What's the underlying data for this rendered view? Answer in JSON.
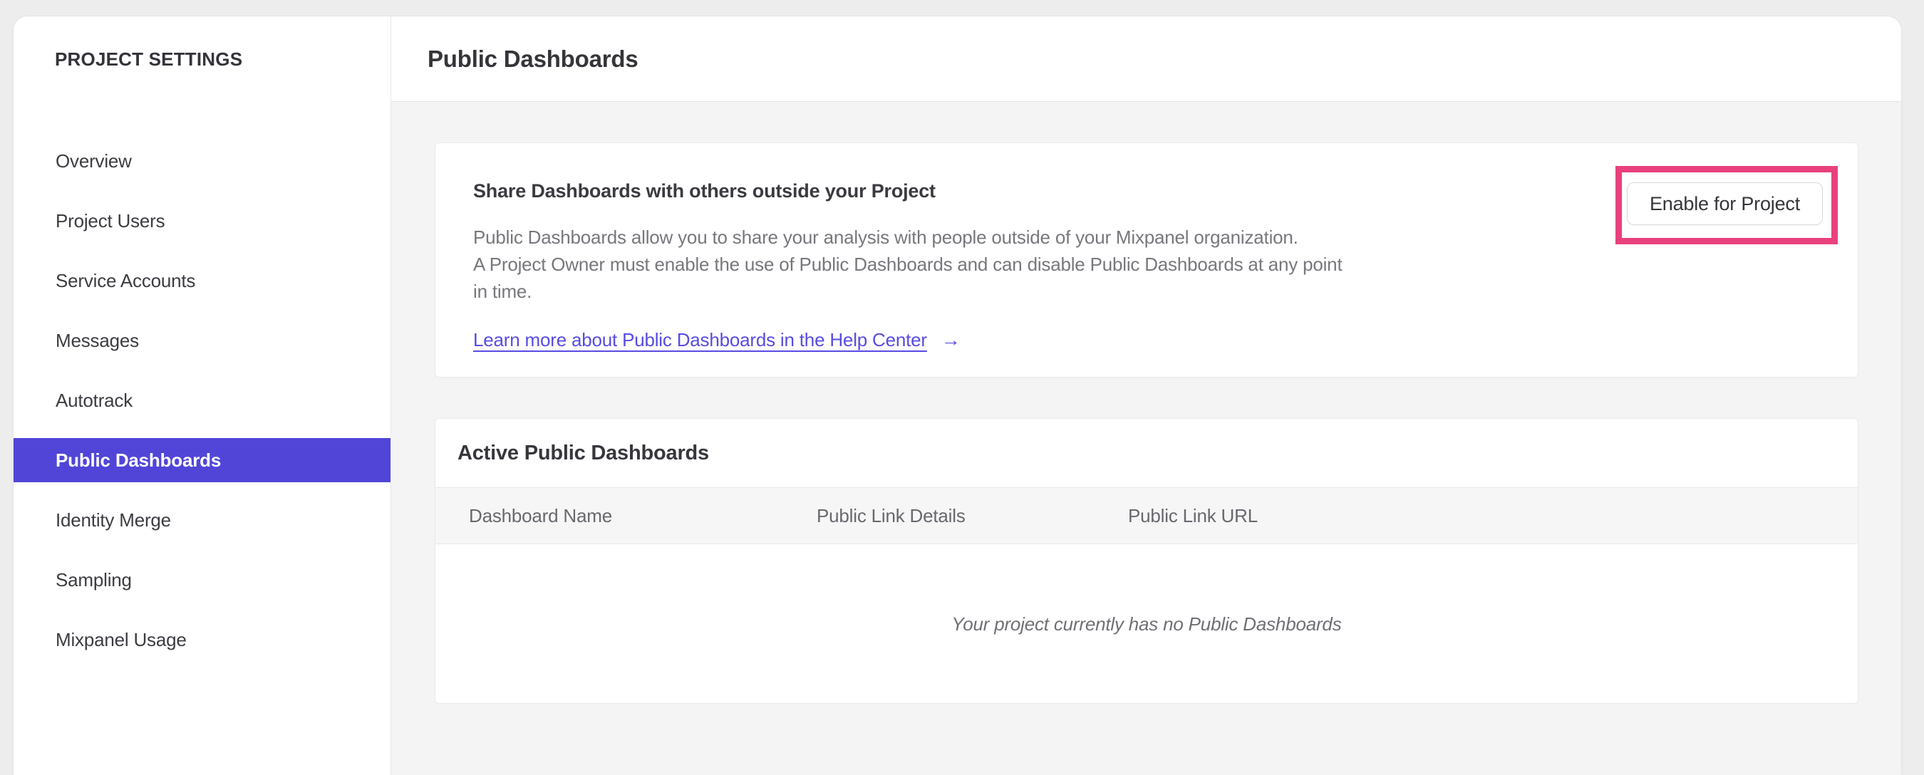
{
  "sidebar": {
    "title": "PROJECT SETTINGS",
    "items": [
      {
        "label": "Overview"
      },
      {
        "label": "Project Users"
      },
      {
        "label": "Service Accounts"
      },
      {
        "label": "Messages"
      },
      {
        "label": "Autotrack"
      },
      {
        "label": "Public Dashboards",
        "active": true
      },
      {
        "label": "Identity Merge"
      },
      {
        "label": "Sampling"
      },
      {
        "label": "Mixpanel Usage"
      }
    ]
  },
  "header": {
    "title": "Public Dashboards"
  },
  "share_card": {
    "heading": "Share Dashboards with others outside your Project",
    "body_lines": [
      "Public Dashboards allow you to share your analysis with people outside of your Mixpanel organization.",
      "A Project Owner must enable the use of Public Dashboards and can disable Public Dashboards at any point",
      "in time."
    ],
    "link_label": "Learn more about Public Dashboards in the Help Center",
    "link_arrow": "→",
    "button_label": "Enable for Project"
  },
  "dashboards_card": {
    "title": "Active Public Dashboards",
    "columns": [
      "Dashboard Name",
      "Public Link Details",
      "Public Link URL"
    ],
    "empty_message": "Your project currently has no Public Dashboards"
  },
  "colors": {
    "accent_purple": "#5145d8",
    "highlight_pink": "#e8417d",
    "link_indigo": "#574ce2",
    "content_background": "#f4f4f5",
    "page_background": "#ededee"
  }
}
